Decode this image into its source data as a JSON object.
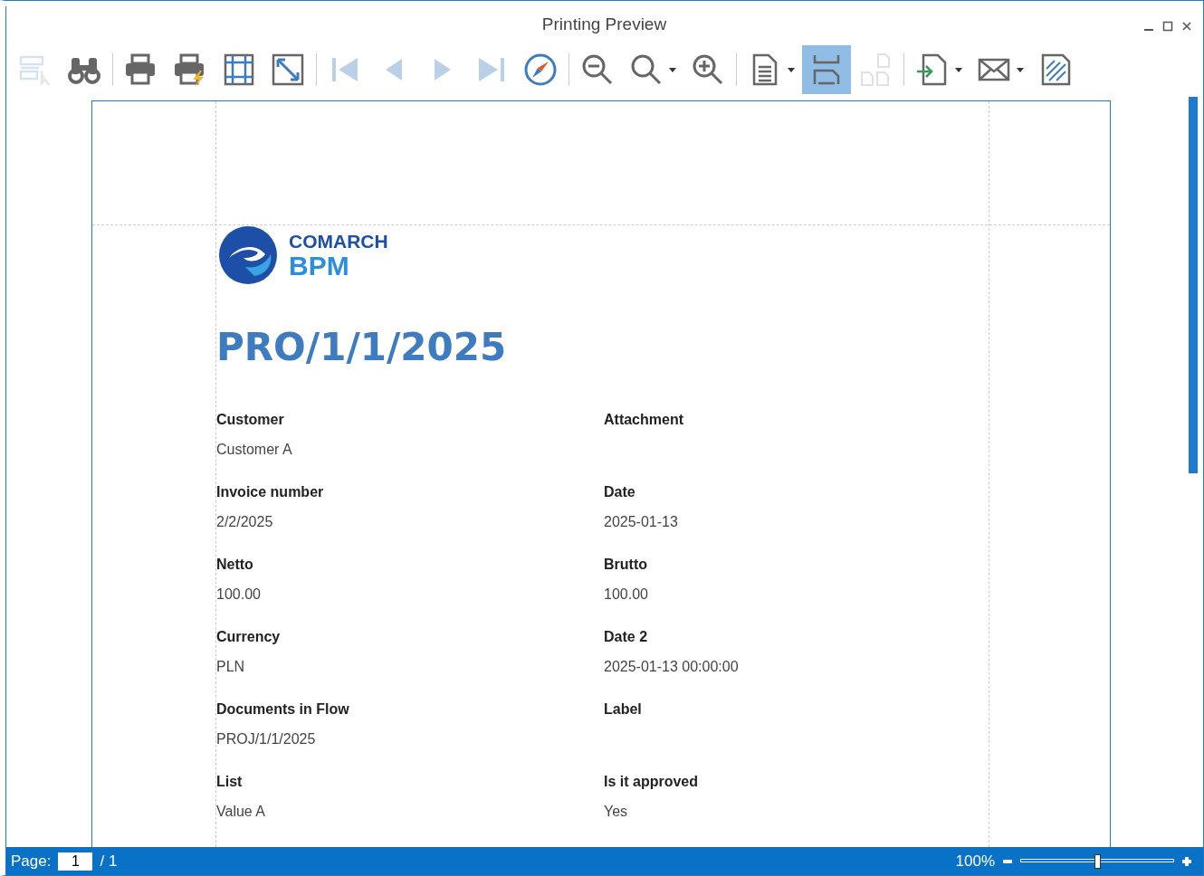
{
  "window": {
    "title": "Printing Preview"
  },
  "toolbar": [
    {
      "kind": "select",
      "disabled": true,
      "selected": false,
      "dropdown": false
    },
    {
      "kind": "find",
      "disabled": false,
      "selected": false,
      "dropdown": false
    },
    {
      "kind": "separator"
    },
    {
      "kind": "print",
      "disabled": false,
      "selected": false,
      "dropdown": false
    },
    {
      "kind": "quick-print",
      "disabled": false,
      "selected": false,
      "dropdown": false
    },
    {
      "kind": "margins",
      "disabled": false,
      "selected": false,
      "dropdown": false
    },
    {
      "kind": "scale",
      "disabled": false,
      "selected": false,
      "dropdown": false
    },
    {
      "kind": "separator"
    },
    {
      "kind": "first",
      "disabled": true,
      "selected": false,
      "dropdown": false
    },
    {
      "kind": "prev",
      "disabled": true,
      "selected": false,
      "dropdown": false
    },
    {
      "kind": "next",
      "disabled": true,
      "selected": false,
      "dropdown": false
    },
    {
      "kind": "last",
      "disabled": true,
      "selected": false,
      "dropdown": false
    },
    {
      "kind": "navigator",
      "disabled": false,
      "selected": false,
      "dropdown": false
    },
    {
      "kind": "separator"
    },
    {
      "kind": "zoom-out",
      "disabled": false,
      "selected": false,
      "dropdown": false
    },
    {
      "kind": "zoom",
      "disabled": false,
      "selected": false,
      "dropdown": true
    },
    {
      "kind": "zoom-in",
      "disabled": false,
      "selected": false,
      "dropdown": false
    },
    {
      "kind": "separator"
    },
    {
      "kind": "page-setup",
      "disabled": false,
      "selected": false,
      "dropdown": true
    },
    {
      "kind": "single-page",
      "disabled": false,
      "selected": true,
      "dropdown": false
    },
    {
      "kind": "multi-page",
      "disabled": true,
      "selected": false,
      "dropdown": false
    },
    {
      "kind": "separator"
    },
    {
      "kind": "export",
      "disabled": false,
      "selected": false,
      "dropdown": true
    },
    {
      "kind": "email",
      "disabled": false,
      "selected": false,
      "dropdown": true
    },
    {
      "kind": "watermark",
      "disabled": false,
      "selected": false,
      "dropdown": false
    }
  ],
  "page": {
    "logo": {
      "line1": "COMARCH",
      "line2": "BPM"
    },
    "title": "PRO/1/1/2025",
    "fields": [
      {
        "label": "Customer",
        "value": "Customer A"
      },
      {
        "label": "Attachment"
      },
      {
        "label": "Invoice number",
        "value": "2/2/2025"
      },
      {
        "label": "Date",
        "value": "2025-01-13"
      },
      {
        "label": "Netto",
        "value": "100.00"
      },
      {
        "label": "Brutto",
        "value": "100.00"
      },
      {
        "label": "Currency",
        "value": "PLN"
      },
      {
        "label": "Date 2",
        "value": "2025-01-13 00:00:00"
      },
      {
        "label": "Documents in Flow",
        "value": "PROJ/1/1/2025"
      },
      {
        "label": "Label"
      },
      {
        "label": "List",
        "value": "Value A"
      },
      {
        "label": "Is it approved",
        "value": "Yes"
      }
    ]
  },
  "status_bar": {
    "page_label": "Page:",
    "page_value": "1",
    "page_total": "/ 1",
    "zoom": "100%",
    "zoom_slider": {
      "level": 0.5
    }
  }
}
